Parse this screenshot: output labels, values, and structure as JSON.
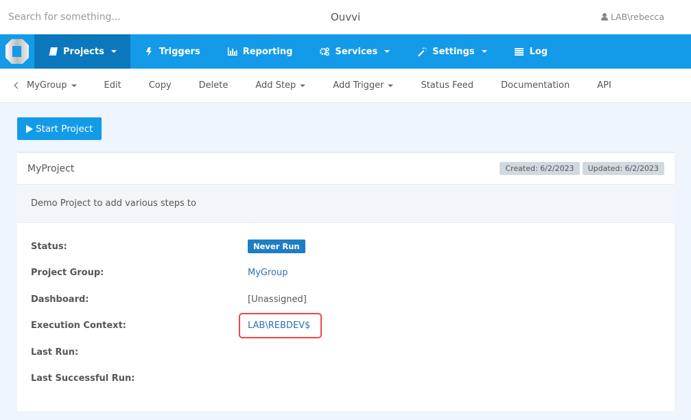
{
  "topbar": {
    "search_placeholder": "Search for something...",
    "app_title": "Ouvvi",
    "user": "LAB\\rebecca"
  },
  "navbar": {
    "items": [
      {
        "label": "Projects",
        "icon": "book-icon",
        "dropdown": true,
        "active": true
      },
      {
        "label": "Triggers",
        "icon": "bolt-icon",
        "dropdown": false
      },
      {
        "label": "Reporting",
        "icon": "bar-chart-icon",
        "dropdown": false
      },
      {
        "label": "Services",
        "icon": "gears-icon",
        "dropdown": true
      },
      {
        "label": "Settings",
        "icon": "magic-wand-icon",
        "dropdown": true
      },
      {
        "label": "Log",
        "icon": "list-icon",
        "dropdown": false
      }
    ]
  },
  "subbar": {
    "back_group": "MyGroup",
    "items": [
      "Edit",
      "Copy",
      "Delete",
      "Add Step",
      "Add Trigger",
      "Status Feed",
      "Documentation",
      "API"
    ]
  },
  "actions": {
    "start_project": "Start Project"
  },
  "project": {
    "name": "MyProject",
    "created": "Created: 6/2/2023",
    "updated": "Updated: 6/2/2023",
    "description": "Demo Project to add various steps to",
    "fields": {
      "status_label": "Status:",
      "status_value": "Never Run",
      "group_label": "Project Group:",
      "group_value": "MyGroup",
      "dashboard_label": "Dashboard:",
      "dashboard_value": "[Unassigned]",
      "context_label": "Execution Context:",
      "context_value": "LAB\\REBDEV$",
      "last_run_label": "Last Run:",
      "last_run_value": "",
      "last_success_label": "Last Successful Run:",
      "last_success_value": ""
    }
  },
  "colors": {
    "nav_bg": "#139be9",
    "nav_active": "#0b78bd",
    "status_badge": "#1e7dc4",
    "link": "#2b6fb5",
    "highlight": "#ee4444"
  }
}
